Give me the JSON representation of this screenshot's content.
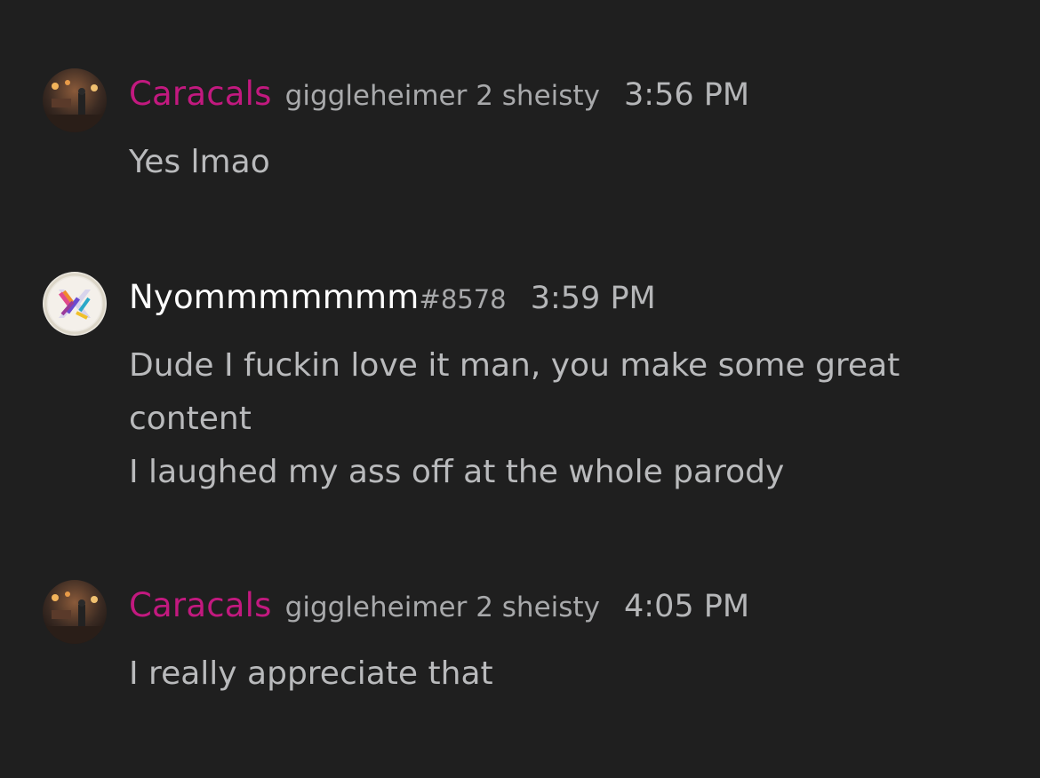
{
  "messages": [
    {
      "author": "Caracals",
      "tag": "giggleheimer 2 sheisty",
      "time": "3:56 PM",
      "lines": [
        "Yes lmao"
      ],
      "author_color": "#c2197f"
    },
    {
      "author": "Nyommmmmmm",
      "discriminator": "#8578",
      "time": "3:59 PM",
      "lines": [
        "Dude I fuckin love it man, you make some great",
        "content",
        "I laughed my ass off at the whole parody"
      ],
      "author_color": "#ffffff"
    },
    {
      "author": "Caracals",
      "tag": "giggleheimer 2 sheisty",
      "time": "4:05 PM",
      "lines": [
        "I really appreciate that"
      ],
      "author_color": "#c2197f"
    }
  ]
}
